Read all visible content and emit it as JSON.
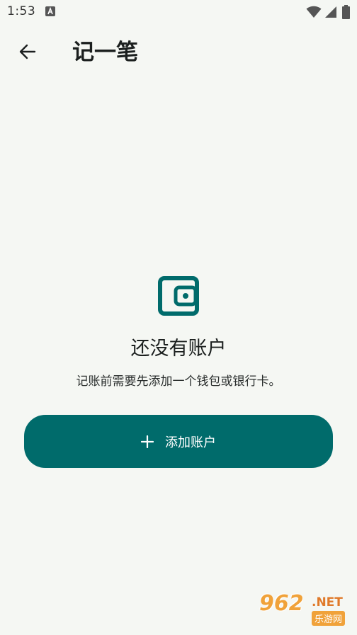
{
  "status_bar": {
    "time": "1:53",
    "icons": [
      "a-notification-icon",
      "wifi-icon",
      "signal-icon",
      "battery-icon"
    ]
  },
  "app_bar": {
    "back_icon": "arrow-left-icon",
    "title": "记一笔"
  },
  "empty_state": {
    "icon": "wallet-icon",
    "title": "还没有账户",
    "subtitle": "记账前需要先添加一个钱包或银行卡。"
  },
  "add_button": {
    "icon": "plus-icon",
    "label": "添加账户"
  },
  "watermark": {
    "number": "962",
    "net": ".NET",
    "site_name": "乐游网"
  },
  "colors": {
    "background": "#f5f7f3",
    "accent": "#006b6b",
    "text": "#1b1f1e"
  }
}
